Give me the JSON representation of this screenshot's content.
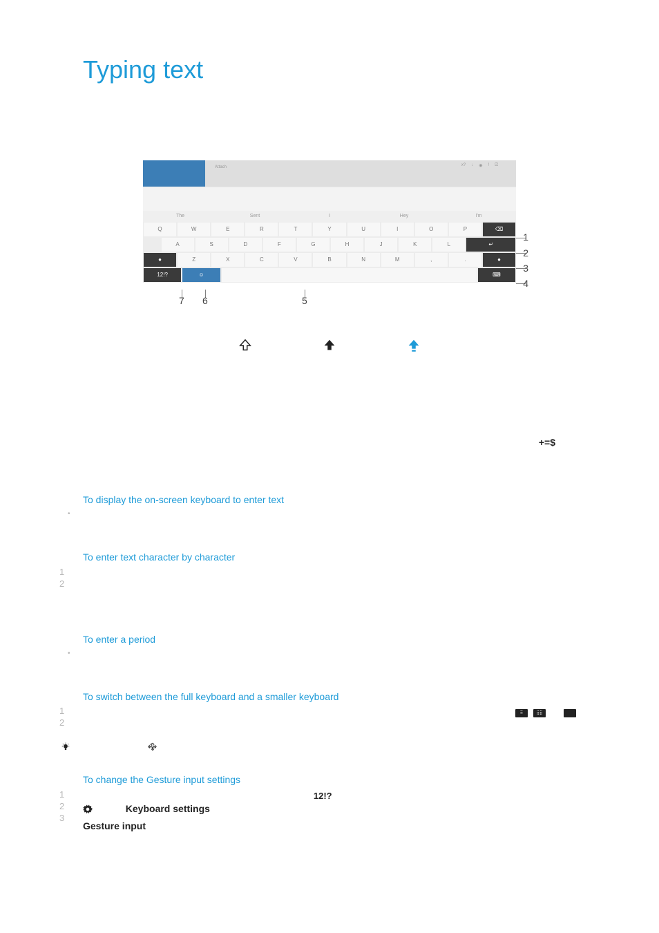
{
  "title": "Typing text",
  "keyboard": {
    "top_label": "Attach",
    "top_icons": [
      "x?",
      "↓",
      "◉",
      "!",
      "⎚"
    ],
    "tabs": [
      "The",
      "Sent",
      "I",
      "Hey",
      "I'm"
    ],
    "row1": [
      "Q",
      "W",
      "E",
      "R",
      "T",
      "Y",
      "U",
      "I",
      "O",
      "P",
      "⌫"
    ],
    "row2": [
      "A",
      "S",
      "D",
      "F",
      "G",
      "H",
      "J",
      "K",
      "L",
      "↵"
    ],
    "row3": [
      "●",
      "Z",
      "X",
      "C",
      "V",
      "B",
      "N",
      "M",
      ",",
      ".",
      "●"
    ],
    "row4": [
      "12!?",
      "☺",
      " "
    ],
    "row4_right": "⌨",
    "callouts": {
      "1": "1",
      "2": "2",
      "3": "3",
      "4": "4",
      "5": "5",
      "6": "6",
      "7": "7"
    }
  },
  "symbols_key": "+=$",
  "sections": {
    "display": {
      "heading": "To display the on-screen keyboard to enter text"
    },
    "enter_char": {
      "heading": "To enter text character by character"
    },
    "period": {
      "heading": "To enter a period"
    },
    "switch": {
      "heading": "To switch between the full keyboard and a smaller keyboard"
    },
    "gesture": {
      "heading": "To change the Gesture input settings",
      "kb12": "12!?",
      "kb_settings": "Keyboard settings",
      "gesture_input": "Gesture input"
    }
  },
  "nums": {
    "n1": "1",
    "n2": "2",
    "n3": "3"
  }
}
